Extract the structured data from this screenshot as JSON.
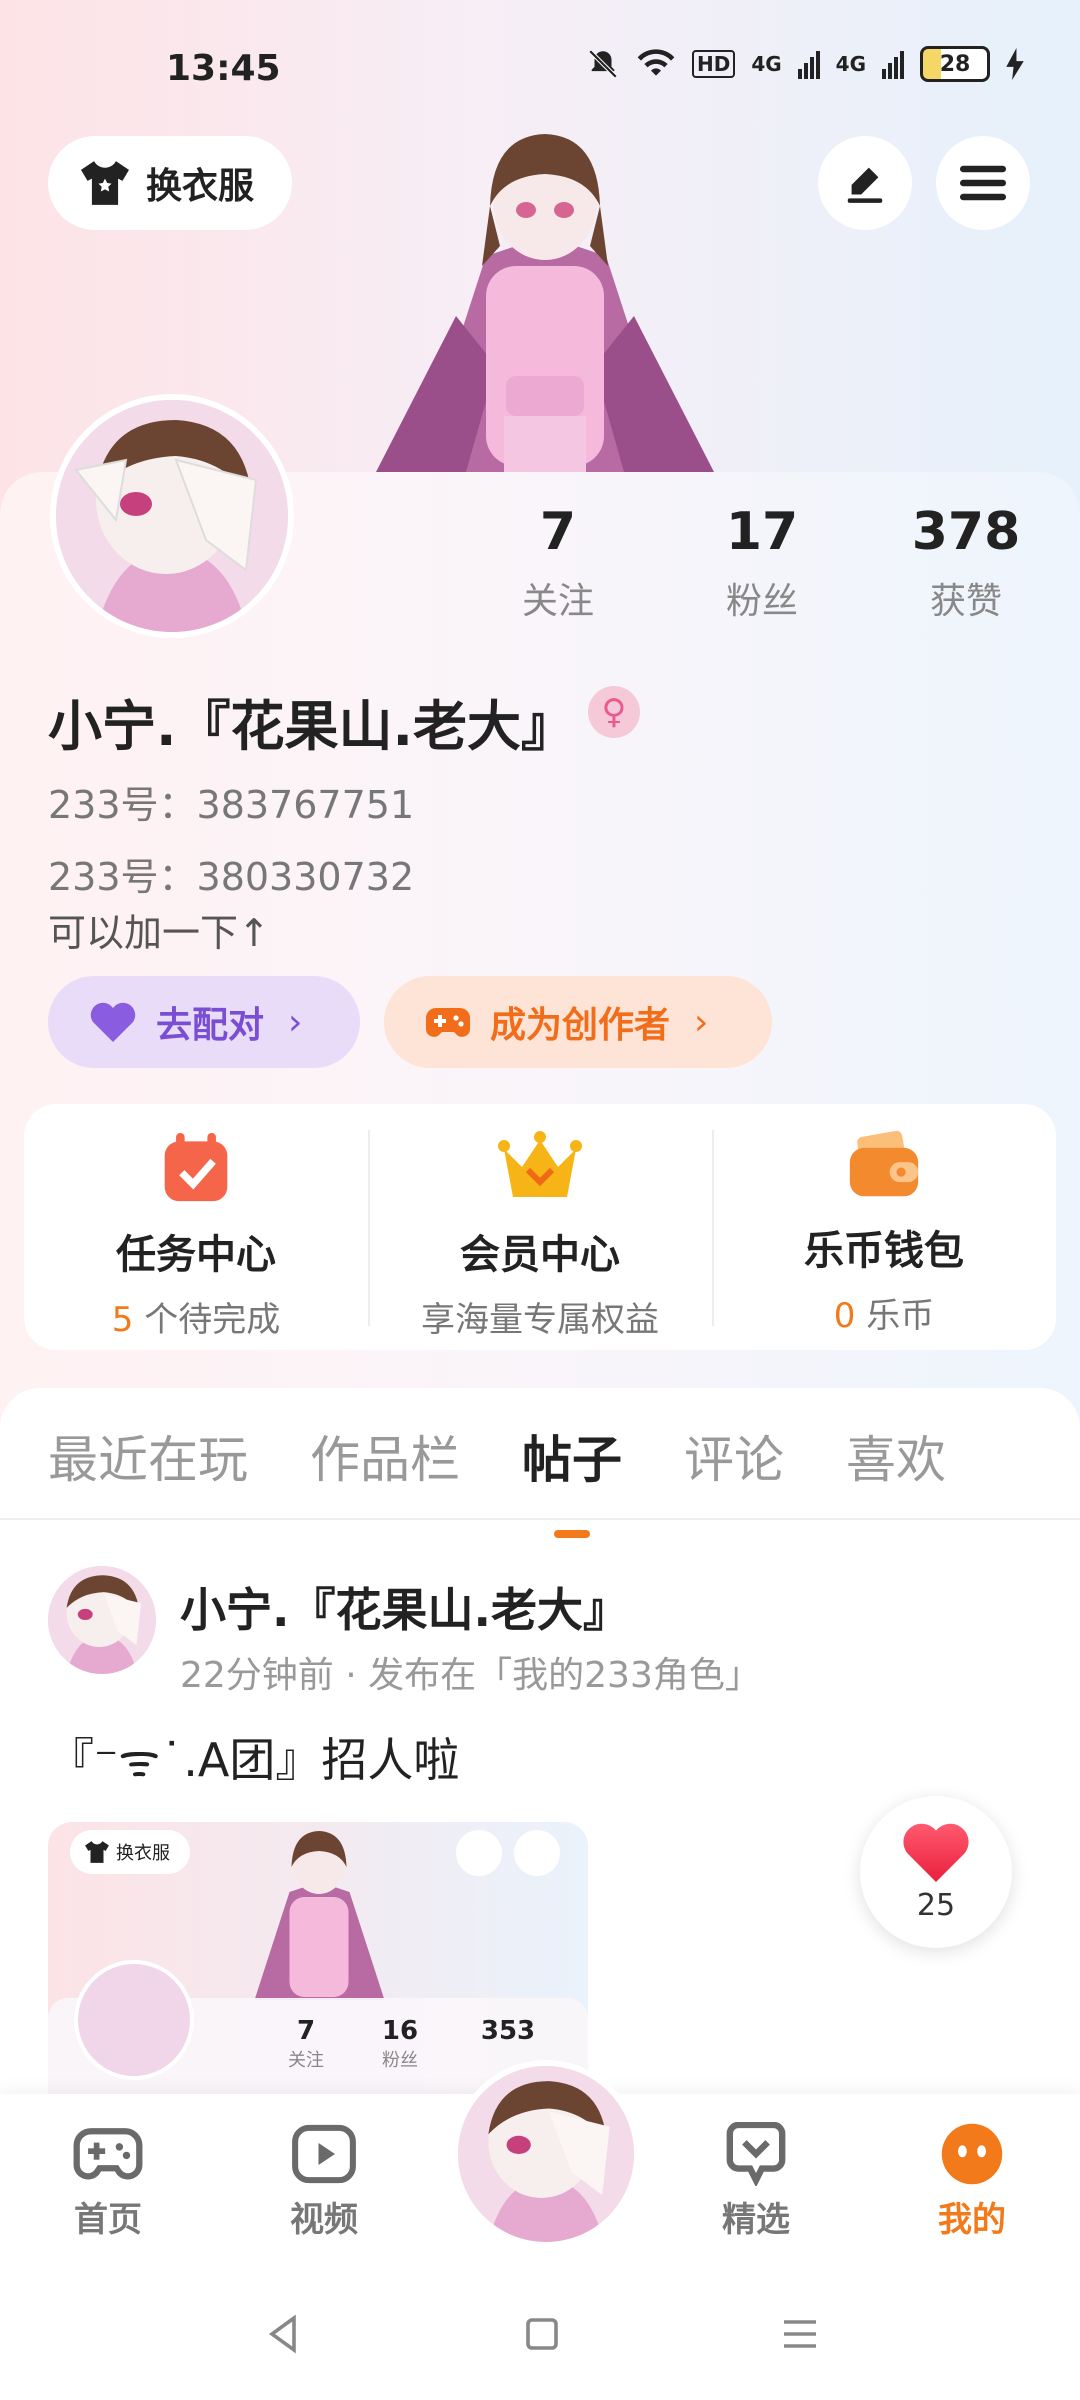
{
  "status_bar": {
    "time": "13:45",
    "battery": "28",
    "net1": "4G",
    "net2": "4G",
    "hd": "HD"
  },
  "header": {
    "dress_label": "换衣服"
  },
  "profile": {
    "stats": [
      {
        "num": "7",
        "label": "关注"
      },
      {
        "num": "17",
        "label": "粉丝"
      },
      {
        "num": "378",
        "label": "获赞"
      }
    ],
    "name": "小宁.『花果山.老大』",
    "id_line1": "233号：383767751",
    "id_line2": "233号：380330732",
    "bio": "可以加一下↑",
    "match_label": "去配对",
    "creator_label": "成为创作者"
  },
  "quick": [
    {
      "title": "任务中心",
      "count": "5",
      "sub": "个待完成"
    },
    {
      "title": "会员中心",
      "count": "",
      "sub": "享海量专属权益"
    },
    {
      "title": "乐币钱包",
      "count": "0",
      "sub": "乐币"
    }
  ],
  "tabs": [
    "最近在玩",
    "作品栏",
    "帖子",
    "评论",
    "喜欢"
  ],
  "post": {
    "author": "小宁.『花果山.老大』",
    "meta": "22分钟前 · 发布在「我的233角色」",
    "text": "『⁻ᯤ˙.A团』招人啦",
    "like_count": "25",
    "thumb": {
      "dress_label": "换衣服",
      "stats": [
        {
          "num": "7",
          "label": "关注"
        },
        {
          "num": "16",
          "label": "粉丝"
        },
        {
          "num": "353",
          "label": ""
        }
      ]
    }
  },
  "nav": [
    {
      "label": "首页",
      "icon": "gamepad-icon"
    },
    {
      "label": "视频",
      "icon": "play-icon"
    },
    {
      "label": "精选",
      "icon": "heart-chat-icon"
    },
    {
      "label": "我的",
      "icon": "face-icon"
    }
  ],
  "colors": {
    "accent": "#f27a1a",
    "purple": "#7a4ed4"
  }
}
